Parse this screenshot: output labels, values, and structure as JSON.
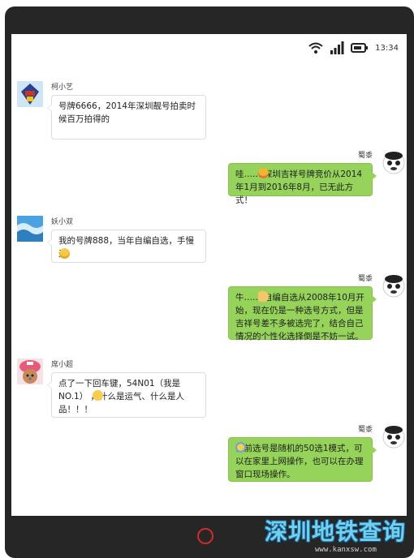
{
  "status_bar": {
    "time": "13:34",
    "icons": [
      "wifi-icon",
      "signal-icon",
      "battery-icon"
    ]
  },
  "messages": [
    {
      "side": "left",
      "name": "柯小艺",
      "avatar": "robot-avatar",
      "text": "号牌6666，2014年深圳靓号拍卖时候百万拍得的"
    },
    {
      "side": "right",
      "name": "蜀黍",
      "avatar": "panda-avatar",
      "text": "哇…… 深圳吉祥号牌竞价从2014年1月到2016年8月，已无此方式！",
      "emoji": "money-face-emoji"
    },
    {
      "side": "left",
      "name": "妖小双",
      "avatar": "wave-avatar",
      "text": "我的号牌888，当年自编自选，手慢无",
      "emoji": "sweat-emoji"
    },
    {
      "side": "right",
      "name": "蜀黍",
      "avatar": "panda-avatar",
      "text": "牛…… 自编自选从2008年10月开始，现在仍是一种选号方式，但是吉祥号差不多被选完了，结合自己情况的个性化选择倒是不妨一试。",
      "emoji": "thumbs-up-emoji"
    },
    {
      "side": "left",
      "name": "席小超",
      "avatar": "chopper-avatar",
      "text": "点了一下回车键，54N01（我是NO.1） ，什么是运气、什么是人品！！！",
      "emoji": "thinking-emoji"
    },
    {
      "side": "right",
      "name": "蜀黍",
      "avatar": "panda-avatar",
      "text": " 目前选号是随机的50选1模式，可以在家里上网操作，也可以在办理窗口现场操作。",
      "emoji": "scream-emoji"
    }
  ],
  "watermark": {
    "title": "深圳地铁查询",
    "url": "www.kanxsw.com"
  },
  "colors": {
    "bubble_right": "#95d35a",
    "phone_frame": "#262626",
    "home_button": "#d12a2a"
  }
}
